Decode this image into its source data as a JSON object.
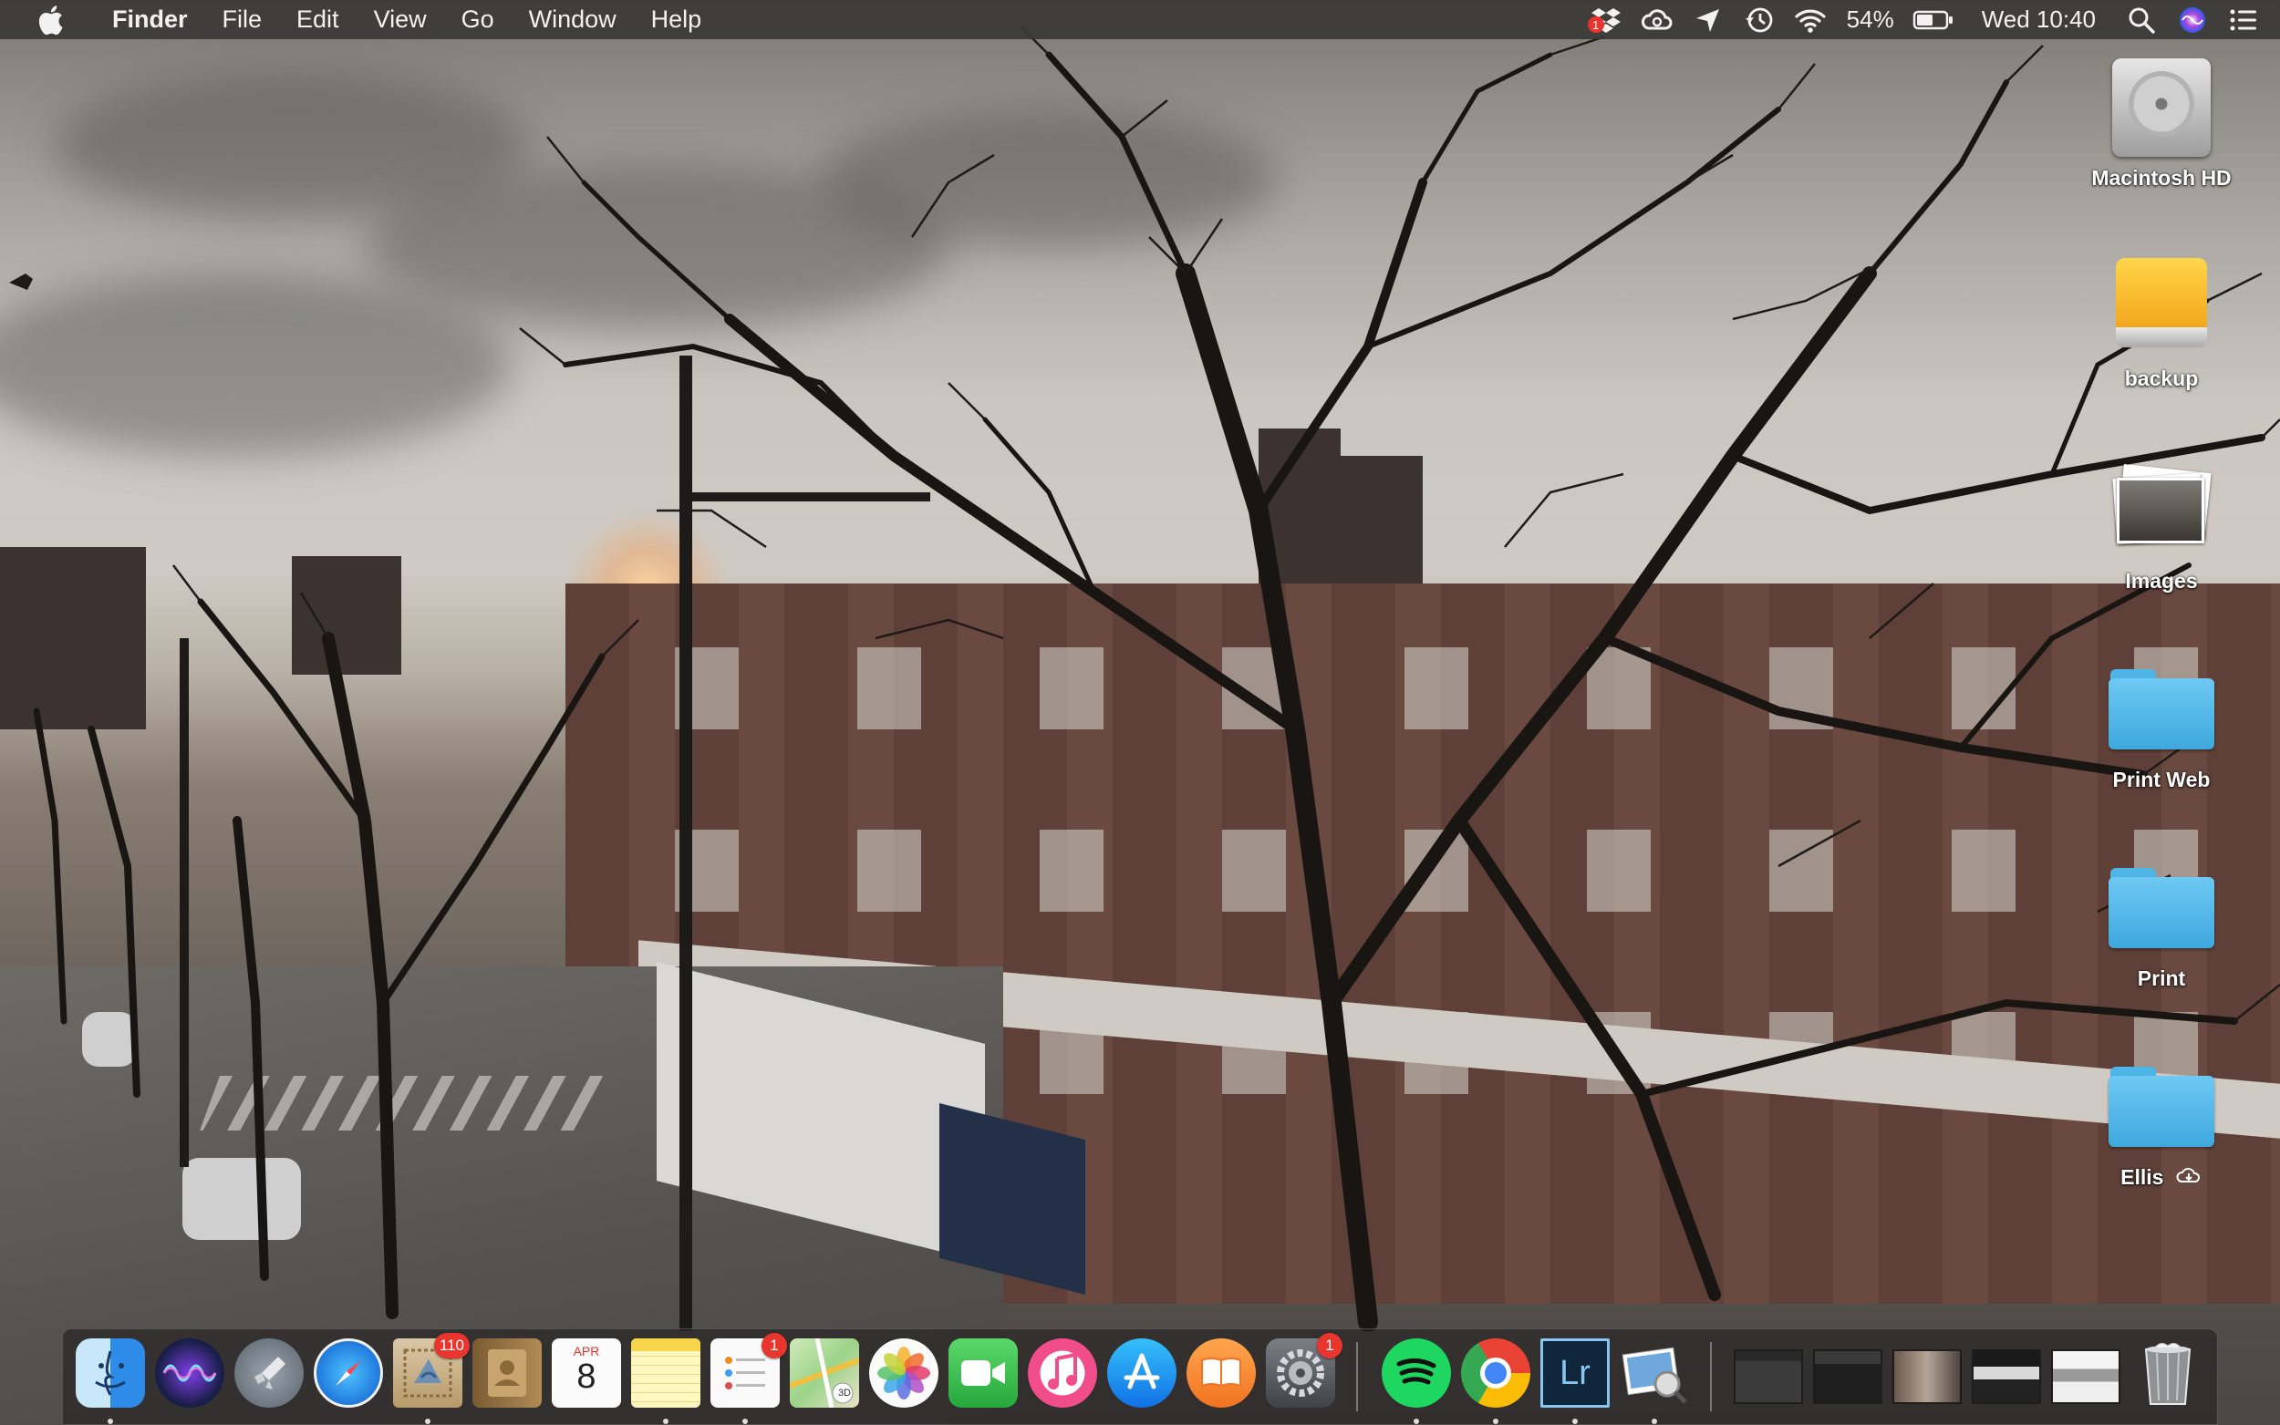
{
  "menubar": {
    "apple_icon": "apple-logo",
    "app_name": "Finder",
    "menus": [
      "File",
      "Edit",
      "View",
      "Go",
      "Window",
      "Help"
    ],
    "status": {
      "dropbox_badge": "1",
      "battery_percent": "54%",
      "clock": "Wed 10:40"
    },
    "status_icons": [
      "dropbox-icon",
      "creative-cloud-icon",
      "location-icon",
      "time-machine-icon",
      "wifi-icon",
      "battery-icon",
      "spotlight-icon",
      "siri-icon",
      "notification-center-icon"
    ]
  },
  "desktop": {
    "icons": [
      {
        "label": "Macintosh HD",
        "kind": "hard-drive"
      },
      {
        "label": "backup",
        "kind": "external-drive"
      },
      {
        "label": "Images",
        "kind": "photos-stack"
      },
      {
        "label": "Print Web",
        "kind": "folder"
      },
      {
        "label": "Print",
        "kind": "folder"
      },
      {
        "label": "Ellis",
        "kind": "folder-icloud"
      }
    ]
  },
  "dock": {
    "apps": [
      {
        "name": "finder-icon",
        "running": true
      },
      {
        "name": "siri-icon",
        "running": false
      },
      {
        "name": "launchpad-icon",
        "running": false
      },
      {
        "name": "safari-icon",
        "running": false
      },
      {
        "name": "mail-icon",
        "running": true,
        "badge": "110"
      },
      {
        "name": "contacts-icon",
        "running": false
      },
      {
        "name": "calendar-icon",
        "running": false,
        "month": "APR",
        "day": "8"
      },
      {
        "name": "notes-icon",
        "running": true
      },
      {
        "name": "reminders-icon",
        "running": true,
        "badge": "1"
      },
      {
        "name": "maps-icon",
        "running": false,
        "label": "3D"
      },
      {
        "name": "photos-icon",
        "running": false
      },
      {
        "name": "facetime-icon",
        "running": false
      },
      {
        "name": "itunes-icon",
        "running": false
      },
      {
        "name": "app-store-icon",
        "running": false
      },
      {
        "name": "ibooks-icon",
        "running": false
      },
      {
        "name": "system-preferences-icon",
        "running": false,
        "badge": "1"
      },
      {
        "name": "spotify-icon",
        "running": true
      },
      {
        "name": "chrome-icon",
        "running": true
      },
      {
        "name": "lightroom-icon",
        "running": true,
        "label": "Lr"
      },
      {
        "name": "preview-icon",
        "running": true
      },
      {
        "name": "minimized-window-1-icon",
        "running": false
      },
      {
        "name": "minimized-window-2-icon",
        "running": false
      },
      {
        "name": "minimized-window-3-icon",
        "running": false
      },
      {
        "name": "minimized-window-4-icon",
        "running": false
      },
      {
        "name": "minimized-window-5-icon",
        "running": false
      },
      {
        "name": "trash-icon",
        "running": false
      }
    ]
  }
}
